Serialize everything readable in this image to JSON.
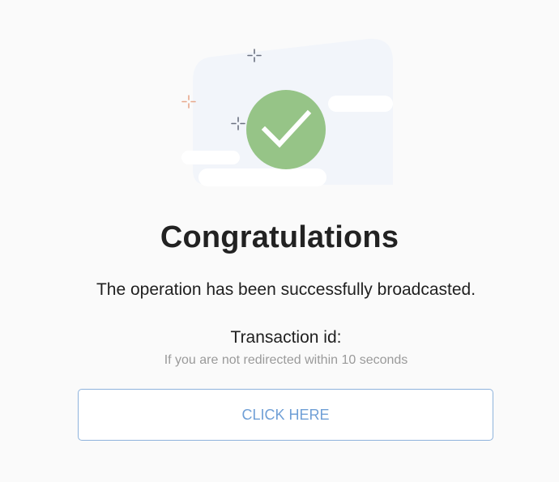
{
  "success": {
    "title": "Congratulations",
    "message": "The operation has been successfully broadcasted.",
    "transaction_label": "Transaction id:",
    "redirect_note": "If you are not redirected within 10 seconds",
    "button_label": "CLICK HERE"
  },
  "illustration": {
    "icon": "check-icon",
    "check_color": "#96c487",
    "accent_sparkle_color": "#e7a88c",
    "sparkle_color": "#6b7180"
  },
  "colors": {
    "button_border": "#8fb3dc",
    "button_text": "#6f9fd6",
    "title_text": "#222222",
    "muted_text": "#9a9a9a"
  }
}
